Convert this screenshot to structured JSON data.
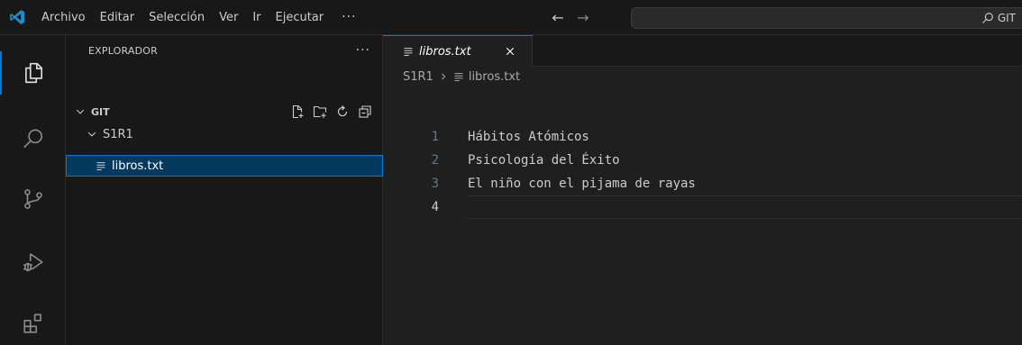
{
  "titlebar": {
    "menu": [
      "Archivo",
      "Editar",
      "Selección",
      "Ver",
      "Ir",
      "Ejecutar"
    ],
    "more": "···",
    "back": "←",
    "forward": "→",
    "search_text": "GIT"
  },
  "activitybar": {
    "items": [
      "explorer-icon",
      "search-icon",
      "source-control-icon",
      "run-debug-icon",
      "extensions-icon"
    ]
  },
  "sidebar": {
    "title": "EXPLORADOR",
    "more": "···",
    "section": "GIT",
    "folder": "S1R1",
    "file": "libros.txt"
  },
  "editor": {
    "tab_label": "libros.txt",
    "breadcrumb_folder": "S1R1",
    "breadcrumb_file": "libros.txt",
    "lines": [
      {
        "num": "1",
        "text": "Hábitos Atómicos"
      },
      {
        "num": "2",
        "text": "Psicología del Éxito"
      },
      {
        "num": "3",
        "text": "El niño con el pijama de rayas"
      },
      {
        "num": "4",
        "text": ""
      }
    ]
  },
  "colors": {
    "accent": "#0078d4",
    "selection": "#04395e",
    "logo": "#2489ca"
  }
}
